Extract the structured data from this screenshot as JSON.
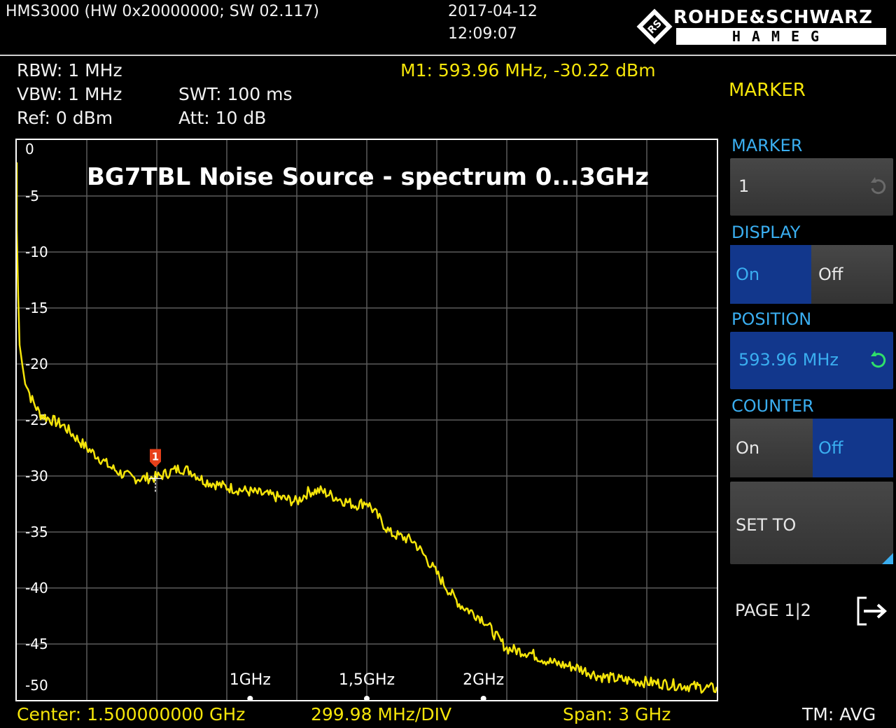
{
  "header": {
    "device": "HMS3000 (HW 0x20000000; SW 02.117)",
    "date": "2017-04-12",
    "time": "12:09:07",
    "brand": "ROHDE&SCHWARZ",
    "brand_sub": "HAMEG"
  },
  "settings": {
    "rbw": "RBW: 1 MHz",
    "vbw": "VBW: 1 MHz",
    "ref": "Ref: 0 dBm",
    "swt": "SWT: 100 ms",
    "att": "Att: 10 dB"
  },
  "marker_readout": "M1: 593.96 MHz, -30.22 dBm",
  "menu": {
    "title": "MARKER",
    "marker_label": "MARKER",
    "marker_value": "1",
    "display_label": "DISPLAY",
    "display_on": "On",
    "display_off": "Off",
    "position_label": "POSITION",
    "position_value": "593.96 MHz",
    "counter_label": "COUNTER",
    "counter_on": "On",
    "counter_off": "Off",
    "set_to": "SET TO",
    "page": "PAGE 1|2"
  },
  "footer": {
    "center": "Center: 1.500000000 GHz",
    "div": "299.98 MHz/DIV",
    "span": "Span: 3 GHz",
    "tm": "TM: AVG"
  },
  "colors": {
    "trace": "#f5e50a",
    "softkey_active": "#12378c",
    "softkey_header": "#3aaef0",
    "marker": "#e8401a"
  },
  "chart_data": {
    "type": "line",
    "title": "BG7TBL Noise Source - spectrum 0...3GHz",
    "xlabel": "",
    "ylabel": "",
    "x_unit": "GHz",
    "xlim": [
      0,
      3.0
    ],
    "ylim": [
      -50,
      0
    ],
    "y_ticks": [
      "0",
      "-5",
      "-10",
      "-15",
      "-20",
      "-25",
      "-30",
      "-35",
      "-40",
      "-45",
      "-50"
    ],
    "x_markers": [
      {
        "label": "1GHz",
        "x": 1.0
      },
      {
        "label": "1,5GHz",
        "x": 1.5
      },
      {
        "label": "2GHz",
        "x": 2.0
      }
    ],
    "grid": true,
    "series": [
      {
        "x": [
          0.0,
          0.01,
          0.03,
          0.06,
          0.1,
          0.15,
          0.2,
          0.25,
          0.3,
          0.35,
          0.4,
          0.45,
          0.5,
          0.55,
          0.6,
          0.65,
          0.7,
          0.75,
          0.8,
          0.9,
          1.0,
          1.1,
          1.2,
          1.25,
          1.3,
          1.4,
          1.45,
          1.5,
          1.55,
          1.6,
          1.7,
          1.75,
          1.8,
          1.85,
          1.9,
          2.0,
          2.05,
          2.1,
          2.2,
          2.25,
          2.3,
          2.4,
          2.45,
          2.5,
          2.6,
          2.7,
          2.8,
          2.9,
          3.0
        ],
        "y": [
          -8,
          -18,
          -21,
          -23,
          -24.5,
          -25,
          -25.5,
          -26.5,
          -27.5,
          -28.3,
          -29.2,
          -29.8,
          -30.2,
          -30.2,
          -30.1,
          -29.7,
          -29.3,
          -29.6,
          -30.4,
          -31,
          -31.4,
          -31.8,
          -32.3,
          -31.4,
          -31.3,
          -32.2,
          -32.6,
          -32.3,
          -33.7,
          -35.1,
          -35.8,
          -37.2,
          -38.7,
          -40.2,
          -41.5,
          -42.8,
          -44.2,
          -45.4,
          -45.8,
          -46.3,
          -46.7,
          -47.1,
          -47.5,
          -47.9,
          -48.2,
          -48.4,
          -48.6,
          -48.8,
          -49.0
        ]
      }
    ],
    "marker": {
      "label": "1",
      "x": 0.59396,
      "y": -30.22
    }
  }
}
